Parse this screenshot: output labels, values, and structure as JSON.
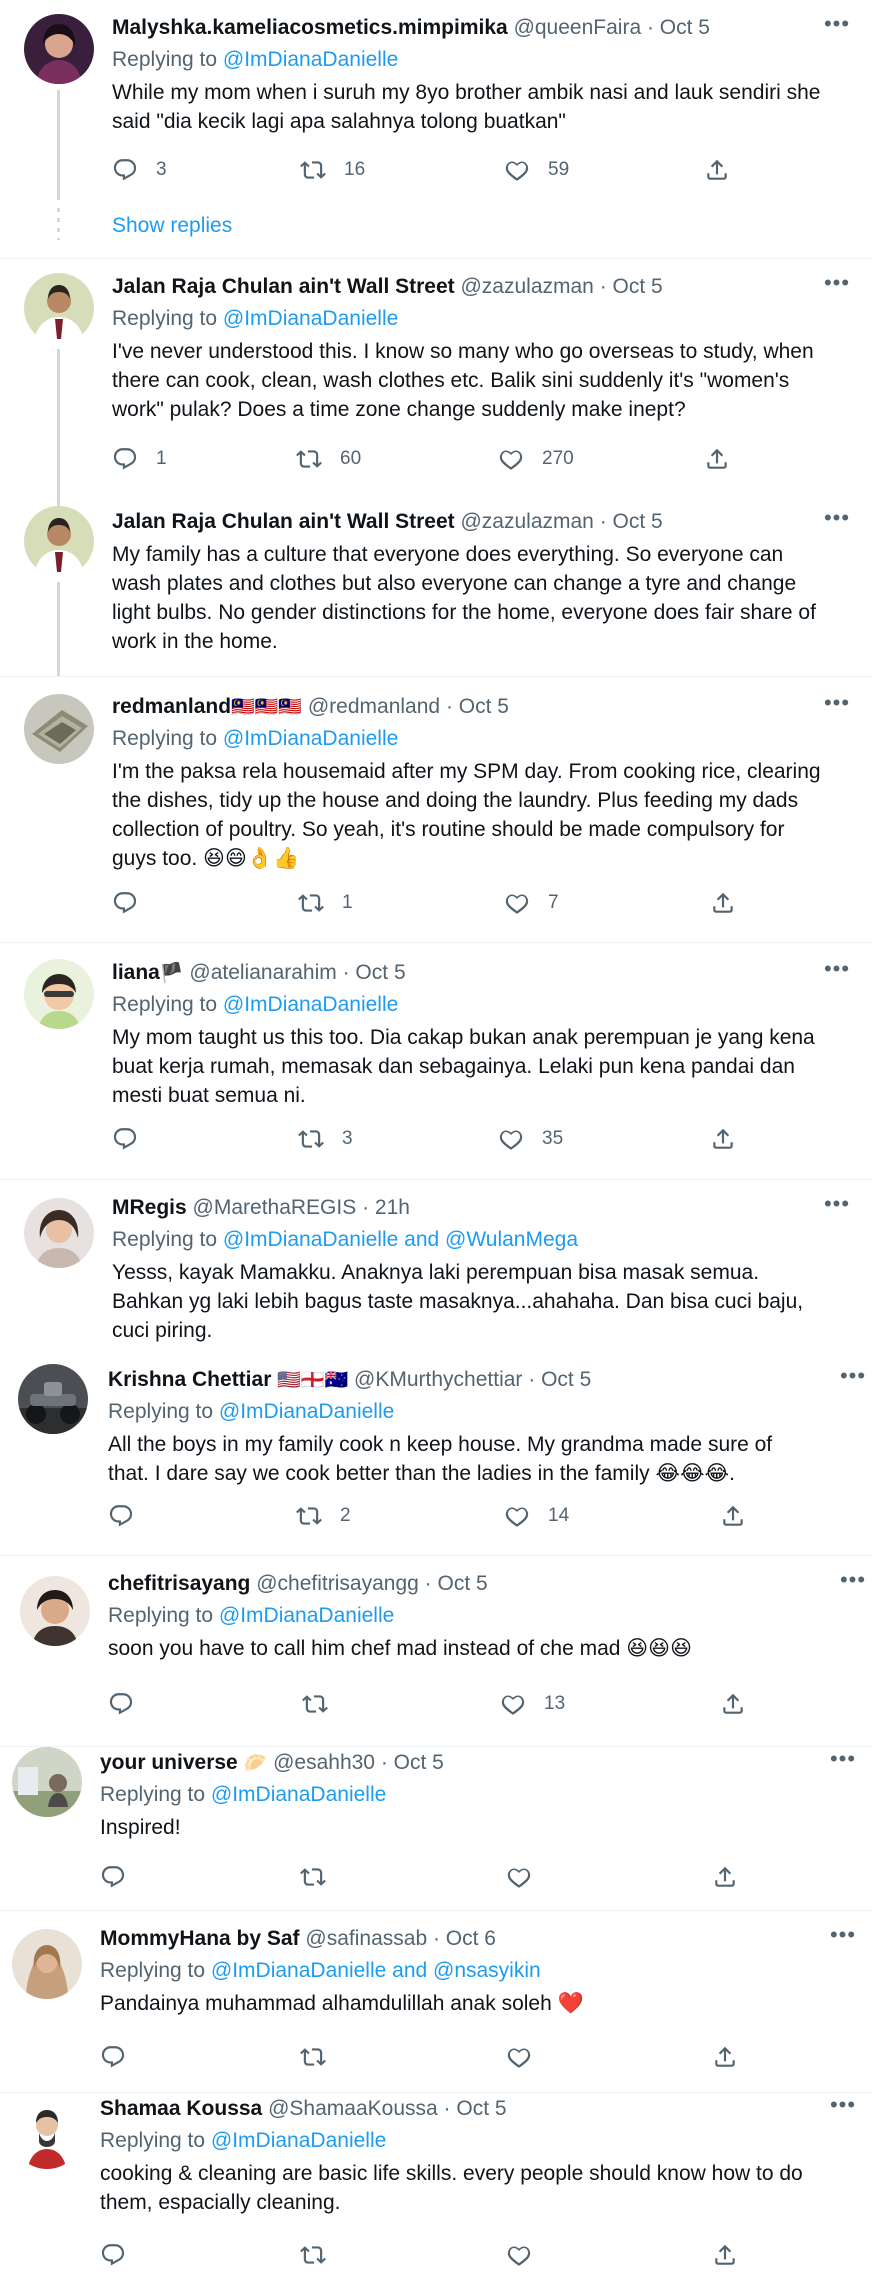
{
  "colors": {
    "accent": "#1d9bf0",
    "text": "#0f1419",
    "muted": "#536471",
    "divider": "#eff3f4",
    "thread": "#cfd9de"
  },
  "icons": {
    "reply": "reply-icon",
    "retweet": "retweet-icon",
    "like": "like-icon",
    "share": "share-icon",
    "more": "more-icon"
  },
  "show_replies_label": "Show replies",
  "tweets": [
    {
      "name": "Malyshka.kameliacosmetics.mimpimika",
      "handle": "@queenFaira",
      "time": "· Oct 5",
      "replying_prefix": "Replying to ",
      "replying_to": "@ImDianaDanielle",
      "lines": [
        "While my mom when i suruh my 8yo brother ambik nasi and lauk sendiri she",
        "said \"dia kecik lagi apa salahnya tolong buatkan\""
      ],
      "replies": "3",
      "retweets": "16",
      "likes": "59"
    },
    {
      "name": "Jalan Raja Chulan ain't Wall Street",
      "handle": "@zazulazman",
      "time": "· Oct 5",
      "replying_prefix": "Replying to ",
      "replying_to": "@ImDianaDanielle",
      "lines": [
        "I've never understood this. I know so many who go overseas to study, when",
        "there can cook, clean, wash clothes etc. Balik sini suddenly it's \"women's",
        "work\" pulak? Does a time zone change suddenly make inept?"
      ],
      "replies": "1",
      "retweets": "60",
      "likes": "270"
    },
    {
      "name": "Jalan Raja Chulan ain't Wall Street",
      "handle": "@zazulazman",
      "time": "· Oct 5",
      "lines": [
        "My family has a culture that everyone does everything. So everyone can",
        "wash plates and clothes but also everyone can change a tyre and change",
        "light bulbs. No gender distinctions for the home, everyone does fair share of",
        "work in the home."
      ]
    },
    {
      "name": "redmanland",
      "flags": "🇲🇾🇲🇾🇲🇾",
      "handle": "@redmanland",
      "time": "· Oct 5",
      "replying_prefix": "Replying to ",
      "replying_to": "@ImDianaDanielle",
      "lines": [
        "I'm the paksa rela housemaid after my SPM day. From cooking rice, clearing",
        "the dishes, tidy up the house and doing the laundry. Plus feeding my dads",
        "collection of poultry. So yeah, it's routine should be made compulsory for",
        "guys too. 😆😄👌👍"
      ],
      "replies": "",
      "retweets": "1",
      "likes": "7"
    },
    {
      "name": "liana",
      "flags": "🏴",
      "handle": "@atelianarahim",
      "time": "· Oct 5",
      "replying_prefix": "Replying to ",
      "replying_to": "@ImDianaDanielle",
      "lines": [
        "My mom taught us this too. Dia cakap bukan anak perempuan je yang kena",
        "buat kerja rumah, memasak dan sebagainya. Lelaki pun kena pandai dan",
        "mesti buat semua ni."
      ],
      "replies": "",
      "retweets": "3",
      "likes": "35"
    },
    {
      "name": "MRegis",
      "handle": "@MarethaREGIS",
      "time": "· 21h",
      "replying_prefix": "Replying to ",
      "replying_to": "@ImDianaDanielle and @WulanMega",
      "lines": [
        "Yesss, kayak Mamakku. Anaknya laki perempuan bisa masak semua.",
        "Bahkan yg laki lebih bagus taste masaknya...ahahaha. Dan bisa cuci baju,",
        "cuci piring."
      ]
    },
    {
      "name": "Krishna Chettiar",
      "flags": "🇺🇸🏴󠁧󠁢󠁥󠁮󠁧󠁿🇦🇺",
      "handle": "@KMurthychettiar",
      "time": "· Oct 5",
      "replying_prefix": "Replying to ",
      "replying_to": "@ImDianaDanielle",
      "lines": [
        "All the boys in my family cook n keep house. My grandma made sure of",
        "that. I dare say we cook better than the ladies in the family 😂😂😂."
      ],
      "replies": "",
      "retweets": "2",
      "likes": "14"
    },
    {
      "name": "chefitrisayang",
      "handle": "@chefitrisayangg",
      "time": "· Oct 5",
      "replying_prefix": "Replying to ",
      "replying_to": "@ImDianaDanielle",
      "lines": [
        "soon you have to call him chef mad instead of che mad 😆😆😆"
      ],
      "replies": "",
      "retweets": "",
      "likes": "13"
    },
    {
      "name": "your universe",
      "flags": "🥟",
      "handle": "@esahh30",
      "time": "· Oct 5",
      "replying_prefix": "Replying to ",
      "replying_to": "@ImDianaDanielle",
      "lines": [
        "Inspired!"
      ],
      "replies": "",
      "retweets": "",
      "likes": ""
    },
    {
      "name": "MommyHana by Saf",
      "handle": "@safinassab",
      "time": "· Oct 6",
      "replying_prefix": "Replying to ",
      "replying_to": "@ImDianaDanielle and @nsasyikin",
      "lines": [
        "Pandainya muhammad alhamdulillah anak soleh ❤️"
      ],
      "replies": "",
      "retweets": "",
      "likes": ""
    },
    {
      "name": "Shamaa Koussa",
      "handle": "@ShamaaKoussa",
      "time": "· Oct 5",
      "replying_prefix": "Replying to ",
      "replying_to": "@ImDianaDanielle",
      "lines": [
        "cooking & cleaning are basic life skills. every people should know how to do",
        "them, espacially cleaning."
      ],
      "replies": "",
      "retweets": "",
      "likes": ""
    }
  ]
}
